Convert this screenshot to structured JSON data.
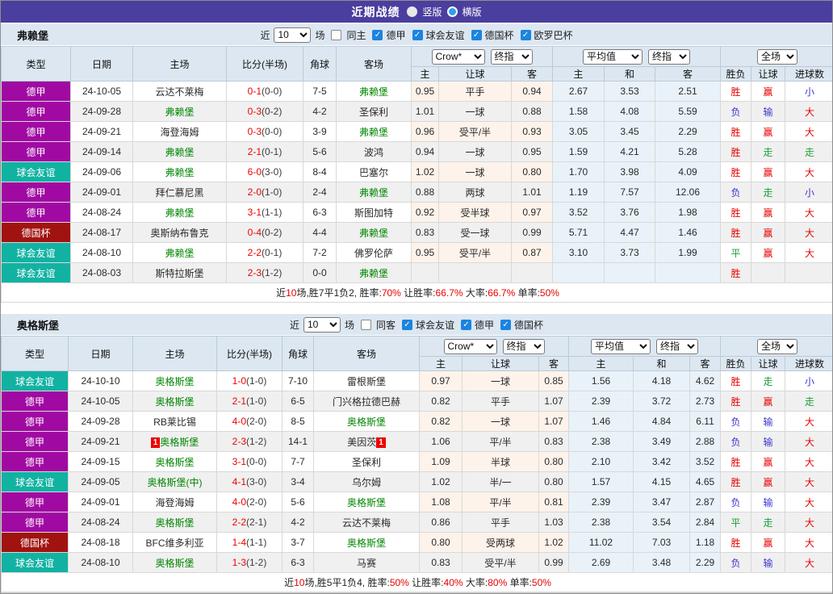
{
  "title_bar": {
    "title": "近期战绩",
    "radio_vertical": "竖版",
    "radio_horizontal": "横版"
  },
  "colors": {
    "title_bar_bg": "#4a3e9e",
    "bundesliga": "#a00aa2",
    "friendly": "#12b2a2",
    "cup": "#a11310",
    "focus_team_green": "#028602",
    "score_red": "#ee0000",
    "win_red": "#e60000",
    "lose_blue": "#3b35d0",
    "draw_green": "#1e9e3e",
    "header_bg": "#dce7f1",
    "row_odd_bg": "#ffffff",
    "row_even_bg": "#f0f0f0",
    "odds_col_odd_bg": "#fdf3ea",
    "avg_col_bg": "#e9f2f8",
    "checkbox_blue": "#1b84e0",
    "radio_accent": "#2e9ff0",
    "summary_number_red": "#e60000"
  },
  "tables": [
    {
      "team": "弗赖堡",
      "filter": {
        "prefix": "近",
        "count": "10",
        "suffix": "场",
        "same_side_label": "同主",
        "same_side_checked": false,
        "leagues": [
          {
            "label": "德甲",
            "checked": true
          },
          {
            "label": "球会友谊",
            "checked": true
          },
          {
            "label": "德国杯",
            "checked": true
          },
          {
            "label": "欧罗巴杯",
            "checked": true
          }
        ]
      },
      "header": {
        "main_columns": [
          "类型",
          "日期",
          "主场",
          "比分(半场)",
          "角球",
          "客场"
        ],
        "selects": {
          "odds_provider": "Crow*",
          "odds_stage": "终指",
          "avg_provider": "平均值",
          "avg_stage": "终指",
          "scope": "全场"
        },
        "sub_columns": [
          "主",
          "让球",
          "客",
          "主",
          "和",
          "客",
          "胜负",
          "让球",
          "进球数"
        ]
      },
      "rows": [
        {
          "league": "德甲",
          "type": "bundesliga",
          "date": "24-10-05",
          "home": "云达不莱梅",
          "score": "0-1",
          "half": "(0-0)",
          "corners": "7-5",
          "away": "弗赖堡",
          "awayGreen": true,
          "odds": [
            "0.95",
            "平手",
            "0.94"
          ],
          "avg": [
            "2.67",
            "3.53",
            "2.51"
          ],
          "result": {
            "text": "胜",
            "color": "r"
          },
          "handicap": {
            "text": "赢",
            "color": "r"
          },
          "goals": {
            "text": "小",
            "color": "b"
          }
        },
        {
          "league": "德甲",
          "type": "bundesliga",
          "date": "24-09-28",
          "home": "弗赖堡",
          "homeGreen": true,
          "score": "0-3",
          "half": "(0-2)",
          "corners": "4-2",
          "away": "圣保利",
          "odds": [
            "1.01",
            "一球",
            "0.88"
          ],
          "avg": [
            "1.58",
            "4.08",
            "5.59"
          ],
          "result": {
            "text": "负",
            "color": "b"
          },
          "handicap": {
            "text": "输",
            "color": "b"
          },
          "goals": {
            "text": "大",
            "color": "r"
          }
        },
        {
          "league": "德甲",
          "type": "bundesliga",
          "date": "24-09-21",
          "home": "海登海姆",
          "score": "0-3",
          "half": "(0-0)",
          "corners": "3-9",
          "away": "弗赖堡",
          "awayGreen": true,
          "odds": [
            "0.96",
            "受平/半",
            "0.93"
          ],
          "avg": [
            "3.05",
            "3.45",
            "2.29"
          ],
          "result": {
            "text": "胜",
            "color": "r"
          },
          "handicap": {
            "text": "赢",
            "color": "r"
          },
          "goals": {
            "text": "大",
            "color": "r"
          }
        },
        {
          "league": "德甲",
          "type": "bundesliga",
          "date": "24-09-14",
          "home": "弗赖堡",
          "homeGreen": true,
          "score": "2-1",
          "half": "(0-1)",
          "corners": "5-6",
          "away": "波鸿",
          "odds": [
            "0.94",
            "一球",
            "0.95"
          ],
          "avg": [
            "1.59",
            "4.21",
            "5.28"
          ],
          "result": {
            "text": "胜",
            "color": "r"
          },
          "handicap": {
            "text": "走",
            "color": "g"
          },
          "goals": {
            "text": "走",
            "color": "g"
          }
        },
        {
          "league": "球会友谊",
          "type": "friendly",
          "date": "24-09-06",
          "home": "弗赖堡",
          "homeGreen": true,
          "score": "6-0",
          "half": "(3-0)",
          "corners": "8-4",
          "away": "巴塞尔",
          "odds": [
            "1.02",
            "一球",
            "0.80"
          ],
          "avg": [
            "1.70",
            "3.98",
            "4.09"
          ],
          "result": {
            "text": "胜",
            "color": "r"
          },
          "handicap": {
            "text": "赢",
            "color": "r"
          },
          "goals": {
            "text": "大",
            "color": "r"
          }
        },
        {
          "league": "德甲",
          "type": "bundesliga",
          "date": "24-09-01",
          "home": "拜仁慕尼黑",
          "score": "2-0",
          "half": "(1-0)",
          "corners": "2-4",
          "away": "弗赖堡",
          "awayGreen": true,
          "odds": [
            "0.88",
            "两球",
            "1.01"
          ],
          "avg": [
            "1.19",
            "7.57",
            "12.06"
          ],
          "result": {
            "text": "负",
            "color": "b"
          },
          "handicap": {
            "text": "走",
            "color": "g"
          },
          "goals": {
            "text": "小",
            "color": "b"
          }
        },
        {
          "league": "德甲",
          "type": "bundesliga",
          "date": "24-08-24",
          "home": "弗赖堡",
          "homeGreen": true,
          "score": "3-1",
          "half": "(1-1)",
          "corners": "6-3",
          "away": "斯图加特",
          "odds": [
            "0.92",
            "受半球",
            "0.97"
          ],
          "avg": [
            "3.52",
            "3.76",
            "1.98"
          ],
          "result": {
            "text": "胜",
            "color": "r"
          },
          "handicap": {
            "text": "赢",
            "color": "r"
          },
          "goals": {
            "text": "大",
            "color": "r"
          }
        },
        {
          "league": "德国杯",
          "type": "cup",
          "date": "24-08-17",
          "home": "奥斯纳布鲁克",
          "score": "0-4",
          "half": "(0-2)",
          "corners": "4-4",
          "away": "弗赖堡",
          "awayGreen": true,
          "odds": [
            "0.83",
            "受一球",
            "0.99"
          ],
          "avg": [
            "5.71",
            "4.47",
            "1.46"
          ],
          "result": {
            "text": "胜",
            "color": "r"
          },
          "handicap": {
            "text": "赢",
            "color": "r"
          },
          "goals": {
            "text": "大",
            "color": "r"
          }
        },
        {
          "league": "球会友谊",
          "type": "friendly",
          "date": "24-08-10",
          "home": "弗赖堡",
          "homeGreen": true,
          "score": "2-2",
          "half": "(0-1)",
          "corners": "7-2",
          "away": "佛罗伦萨",
          "odds": [
            "0.95",
            "受平/半",
            "0.87"
          ],
          "avg": [
            "3.10",
            "3.73",
            "1.99"
          ],
          "result": {
            "text": "平",
            "color": "g"
          },
          "handicap": {
            "text": "赢",
            "color": "r"
          },
          "goals": {
            "text": "大",
            "color": "r"
          }
        },
        {
          "league": "球会友谊",
          "type": "friendly",
          "date": "24-08-03",
          "home": "斯特拉斯堡",
          "score": "2-3",
          "half": "(1-2)",
          "corners": "0-0",
          "away": "弗赖堡",
          "awayGreen": true,
          "odds": [
            "",
            "",
            ""
          ],
          "avg": [
            "",
            "",
            ""
          ],
          "result": {
            "text": "胜",
            "color": "r"
          },
          "handicap": {
            "text": "",
            "color": ""
          },
          "goals": {
            "text": "",
            "color": ""
          }
        }
      ],
      "summary": [
        {
          "text": "近",
          "red": false
        },
        {
          "text": "10",
          "red": true
        },
        {
          "text": "场,胜7平1负2, 胜率:",
          "red": false
        },
        {
          "text": "70%",
          "red": true
        },
        {
          "text": " 让胜率:",
          "red": false
        },
        {
          "text": "66.7%",
          "red": true
        },
        {
          "text": " 大率:",
          "red": false
        },
        {
          "text": "66.7%",
          "red": true
        },
        {
          "text": " 单率:",
          "red": false
        },
        {
          "text": "50%",
          "red": true
        }
      ]
    },
    {
      "team": "奥格斯堡",
      "filter": {
        "prefix": "近",
        "count": "10",
        "suffix": "场",
        "same_side_label": "同客",
        "same_side_checked": false,
        "leagues": [
          {
            "label": "球会友谊",
            "checked": true
          },
          {
            "label": "德甲",
            "checked": true
          },
          {
            "label": "德国杯",
            "checked": true
          }
        ]
      },
      "header": {
        "main_columns": [
          "类型",
          "日期",
          "主场",
          "比分(半场)",
          "角球",
          "客场"
        ],
        "selects": {
          "odds_provider": "Crow*",
          "odds_stage": "终指",
          "avg_provider": "平均值",
          "avg_stage": "终指",
          "scope": "全场"
        },
        "sub_columns": [
          "主",
          "让球",
          "客",
          "主",
          "和",
          "客",
          "胜负",
          "让球",
          "进球数"
        ]
      },
      "rows": [
        {
          "league": "球会友谊",
          "type": "friendly",
          "date": "24-10-10",
          "home": "奥格斯堡",
          "homeGreen": true,
          "score": "1-0",
          "half": "(1-0)",
          "corners": "7-10",
          "away": "雷根斯堡",
          "odds": [
            "0.97",
            "一球",
            "0.85"
          ],
          "avg": [
            "1.56",
            "4.18",
            "4.62"
          ],
          "result": {
            "text": "胜",
            "color": "r"
          },
          "handicap": {
            "text": "走",
            "color": "g"
          },
          "goals": {
            "text": "小",
            "color": "b"
          }
        },
        {
          "league": "德甲",
          "type": "bundesliga",
          "date": "24-10-05",
          "home": "奥格斯堡",
          "homeGreen": true,
          "score": "2-1",
          "half": "(1-0)",
          "corners": "6-5",
          "away": "门兴格拉德巴赫",
          "odds": [
            "0.82",
            "平手",
            "1.07"
          ],
          "avg": [
            "2.39",
            "3.72",
            "2.73"
          ],
          "result": {
            "text": "胜",
            "color": "r"
          },
          "handicap": {
            "text": "赢",
            "color": "r"
          },
          "goals": {
            "text": "走",
            "color": "g"
          }
        },
        {
          "league": "德甲",
          "type": "bundesliga",
          "date": "24-09-28",
          "home": "RB莱比锡",
          "score": "4-0",
          "half": "(2-0)",
          "corners": "8-5",
          "away": "奥格斯堡",
          "awayGreen": true,
          "odds": [
            "0.82",
            "一球",
            "1.07"
          ],
          "avg": [
            "1.46",
            "4.84",
            "6.11"
          ],
          "result": {
            "text": "负",
            "color": "b"
          },
          "handicap": {
            "text": "输",
            "color": "b"
          },
          "goals": {
            "text": "大",
            "color": "r"
          }
        },
        {
          "league": "德甲",
          "type": "bundesliga",
          "date": "24-09-21",
          "home": "奥格斯堡",
          "homeGreen": true,
          "homeCard": "1",
          "score": "2-3",
          "half": "(1-2)",
          "corners": "14-1",
          "away": "美因茨",
          "awayCard": "1",
          "odds": [
            "1.06",
            "平/半",
            "0.83"
          ],
          "avg": [
            "2.38",
            "3.49",
            "2.88"
          ],
          "result": {
            "text": "负",
            "color": "b"
          },
          "handicap": {
            "text": "输",
            "color": "b"
          },
          "goals": {
            "text": "大",
            "color": "r"
          }
        },
        {
          "league": "德甲",
          "type": "bundesliga",
          "date": "24-09-15",
          "home": "奥格斯堡",
          "homeGreen": true,
          "score": "3-1",
          "half": "(0-0)",
          "corners": "7-7",
          "away": "圣保利",
          "odds": [
            "1.09",
            "半球",
            "0.80"
          ],
          "avg": [
            "2.10",
            "3.42",
            "3.52"
          ],
          "result": {
            "text": "胜",
            "color": "r"
          },
          "handicap": {
            "text": "赢",
            "color": "r"
          },
          "goals": {
            "text": "大",
            "color": "r"
          }
        },
        {
          "league": "球会友谊",
          "type": "friendly",
          "date": "24-09-05",
          "home": "奥格斯堡(中)",
          "homeGreen": true,
          "score": "4-1",
          "half": "(3-0)",
          "corners": "3-4",
          "away": "乌尔姆",
          "odds": [
            "1.02",
            "半/一",
            "0.80"
          ],
          "avg": [
            "1.57",
            "4.15",
            "4.65"
          ],
          "result": {
            "text": "胜",
            "color": "r"
          },
          "handicap": {
            "text": "赢",
            "color": "r"
          },
          "goals": {
            "text": "大",
            "color": "r"
          }
        },
        {
          "league": "德甲",
          "type": "bundesliga",
          "date": "24-09-01",
          "home": "海登海姆",
          "score": "4-0",
          "half": "(2-0)",
          "corners": "5-6",
          "away": "奥格斯堡",
          "awayGreen": true,
          "odds": [
            "1.08",
            "平/半",
            "0.81"
          ],
          "avg": [
            "2.39",
            "3.47",
            "2.87"
          ],
          "result": {
            "text": "负",
            "color": "b"
          },
          "handicap": {
            "text": "输",
            "color": "b"
          },
          "goals": {
            "text": "大",
            "color": "r"
          }
        },
        {
          "league": "德甲",
          "type": "bundesliga",
          "date": "24-08-24",
          "home": "奥格斯堡",
          "homeGreen": true,
          "score": "2-2",
          "half": "(2-1)",
          "corners": "4-2",
          "away": "云达不莱梅",
          "odds": [
            "0.86",
            "平手",
            "1.03"
          ],
          "avg": [
            "2.38",
            "3.54",
            "2.84"
          ],
          "result": {
            "text": "平",
            "color": "g"
          },
          "handicap": {
            "text": "走",
            "color": "g"
          },
          "goals": {
            "text": "大",
            "color": "r"
          }
        },
        {
          "league": "德国杯",
          "type": "cup",
          "date": "24-08-18",
          "home": "BFC维多利亚",
          "score": "1-4",
          "half": "(1-1)",
          "corners": "3-7",
          "away": "奥格斯堡",
          "awayGreen": true,
          "odds": [
            "0.80",
            "受两球",
            "1.02"
          ],
          "avg": [
            "11.02",
            "7.03",
            "1.18"
          ],
          "result": {
            "text": "胜",
            "color": "r"
          },
          "handicap": {
            "text": "赢",
            "color": "r"
          },
          "goals": {
            "text": "大",
            "color": "r"
          }
        },
        {
          "league": "球会友谊",
          "type": "friendly",
          "date": "24-08-10",
          "home": "奥格斯堡",
          "homeGreen": true,
          "score": "1-3",
          "half": "(1-2)",
          "corners": "6-3",
          "away": "马赛",
          "odds": [
            "0.83",
            "受平/半",
            "0.99"
          ],
          "avg": [
            "2.69",
            "3.48",
            "2.29"
          ],
          "result": {
            "text": "负",
            "color": "b"
          },
          "handicap": {
            "text": "输",
            "color": "b"
          },
          "goals": {
            "text": "大",
            "color": "r"
          }
        }
      ],
      "summary": [
        {
          "text": "近",
          "red": false
        },
        {
          "text": "10",
          "red": true
        },
        {
          "text": "场,胜5平1负4, 胜率:",
          "red": false
        },
        {
          "text": "50%",
          "red": true
        },
        {
          "text": " 让胜率:",
          "red": false
        },
        {
          "text": "40%",
          "red": true
        },
        {
          "text": " 大率:",
          "red": false
        },
        {
          "text": "80%",
          "red": true
        },
        {
          "text": " 单率:",
          "red": false
        },
        {
          "text": "50%",
          "red": true
        }
      ]
    }
  ]
}
